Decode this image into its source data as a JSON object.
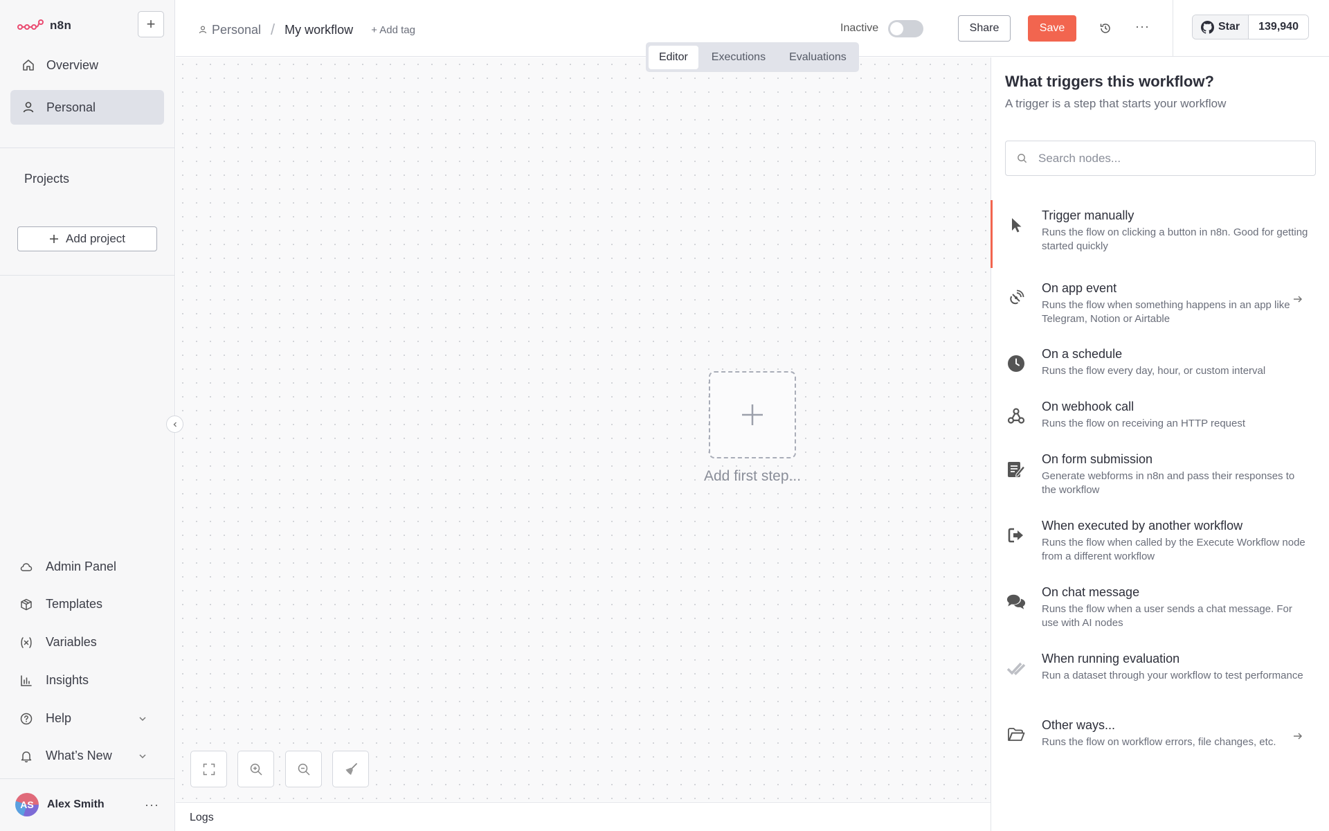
{
  "app": {
    "logo_text": "n8n"
  },
  "sidebar": {
    "new_label": "+",
    "nav": [
      {
        "label": "Overview",
        "icon": "home-icon"
      },
      {
        "label": "Personal",
        "icon": "user-icon",
        "active": true
      }
    ],
    "projects_label": "Projects",
    "add_project_label": "Add project",
    "bottom": [
      {
        "label": "Admin Panel",
        "icon": "cloud-icon"
      },
      {
        "label": "Templates",
        "icon": "box-icon"
      },
      {
        "label": "Variables",
        "icon": "variable-icon"
      },
      {
        "label": "Insights",
        "icon": "chart-icon"
      },
      {
        "label": "Help",
        "icon": "help-icon"
      },
      {
        "label": "What’s New",
        "icon": "bell-icon"
      }
    ],
    "user": {
      "initials": "AS",
      "name": "Alex Smith",
      "more": "···"
    }
  },
  "topbar": {
    "breadcrumb_project": "Personal",
    "breadcrumb_sep": "/",
    "workflow_name": "My workflow",
    "add_tag": "+ Add tag",
    "status_label": "Inactive",
    "share_label": "Share",
    "save_label": "Save",
    "more_label": "···",
    "github": {
      "star_label": "Star",
      "count": "139,940"
    }
  },
  "tabs": [
    {
      "label": "Editor",
      "active": true
    },
    {
      "label": "Executions"
    },
    {
      "label": "Evaluations"
    }
  ],
  "canvas": {
    "add_first_step": "Add first step..."
  },
  "logs": {
    "label": "Logs"
  },
  "panel": {
    "title": "What triggers this workflow?",
    "subtitle": "A trigger is a step that starts your workflow",
    "search_placeholder": "Search nodes...",
    "triggers": [
      {
        "title": "Trigger manually",
        "desc": "Runs the flow on clicking a button in n8n. Good for getting started quickly",
        "icon": "cursor-icon"
      },
      {
        "title": "On app event",
        "desc": "Runs the flow when something happens in an app like Telegram, Notion or Airtable",
        "icon": "satellite-icon"
      },
      {
        "title": "On a schedule",
        "desc": "Runs the flow every day, hour, or custom interval",
        "icon": "clock-icon"
      },
      {
        "title": "On webhook call",
        "desc": "Runs the flow on receiving an HTTP request",
        "icon": "webhook-icon"
      },
      {
        "title": "On form submission",
        "desc": "Generate webforms in n8n and pass their responses to the workflow",
        "icon": "form-icon"
      },
      {
        "title": "When executed by another workflow",
        "desc": "Runs the flow when called by the Execute Workflow node from a different workflow",
        "icon": "sign-in-icon"
      },
      {
        "title": "On chat message",
        "desc": "Runs the flow when a user sends a chat message. For use with AI nodes",
        "icon": "chat-icon"
      },
      {
        "title": "When running evaluation",
        "desc": "Run a dataset through your workflow to test performance",
        "icon": "check-double-icon"
      },
      {
        "title": "Other ways...",
        "desc": "Runs the flow on workflow errors, file changes, etc.",
        "icon": "folder-icon"
      }
    ]
  }
}
